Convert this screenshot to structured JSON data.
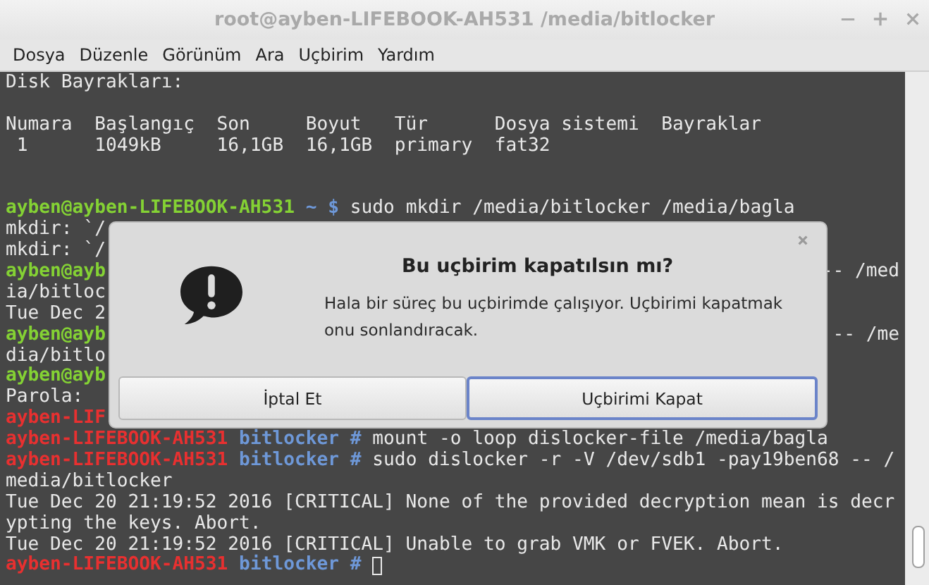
{
  "window": {
    "title": "root@ayben-LIFEBOOK-AH531 /media/bitlocker"
  },
  "menu": [
    "Dosya",
    "Düzenle",
    "Görünüm",
    "Ara",
    "Uçbirim",
    "Yardım"
  ],
  "terminal": {
    "lines": [
      {
        "kind": "text",
        "segments": [
          {
            "kind": "output",
            "text": "Disk Bayrakları:"
          }
        ]
      },
      {
        "kind": "blank"
      },
      {
        "kind": "text",
        "segments": [
          {
            "kind": "output",
            "text": "Numara  Başlangıç  Son     Boyut   Tür      Dosya sistemi  Bayraklar"
          }
        ]
      },
      {
        "kind": "text",
        "segments": [
          {
            "kind": "output",
            "text": " 1      1049kB     16,1GB  16,1GB  primary  fat32"
          }
        ]
      },
      {
        "kind": "blank"
      },
      {
        "kind": "blank"
      },
      {
        "kind": "text",
        "segments": [
          {
            "kind": "user-host",
            "text": "ayben@ayben-LIFEBOOK-AH531"
          },
          {
            "kind": "path",
            "text": " ~ $"
          },
          {
            "kind": "output",
            "text": " sudo mkdir /media/bitlocker /media/bagla"
          }
        ]
      },
      {
        "kind": "text",
        "segments": [
          {
            "kind": "output",
            "text": "mkdir: `/"
          }
        ]
      },
      {
        "kind": "text",
        "segments": [
          {
            "kind": "output",
            "text": "mkdir: `/"
          }
        ]
      },
      {
        "kind": "text",
        "segments": [
          {
            "kind": "user-host",
            "text": "ayben@ayb"
          }
        ],
        "right": "-- /med"
      },
      {
        "kind": "text",
        "segments": [
          {
            "kind": "output",
            "text": "ia/bitloc"
          }
        ]
      },
      {
        "kind": "text",
        "segments": [
          {
            "kind": "output",
            "text": "Tue Dec 2"
          }
        ]
      },
      {
        "kind": "text",
        "segments": [
          {
            "kind": "user-host",
            "text": "ayben@ayb"
          }
        ],
        "right": "-- /me"
      },
      {
        "kind": "text",
        "segments": [
          {
            "kind": "output",
            "text": "dia/bitlo"
          }
        ]
      },
      {
        "kind": "text",
        "segments": [
          {
            "kind": "user-host",
            "text": "ayben@ayb"
          }
        ]
      },
      {
        "kind": "text",
        "segments": [
          {
            "kind": "output",
            "text": "Parola:"
          }
        ]
      },
      {
        "kind": "text",
        "segments": [
          {
            "kind": "root-host",
            "text": "ayben-LIF"
          }
        ]
      },
      {
        "kind": "text",
        "segments": [
          {
            "kind": "root-host",
            "text": "ayben-LIFEBOOK-AH531"
          },
          {
            "kind": "path",
            "text": " bitlocker #"
          },
          {
            "kind": "output",
            "text": " mount -o loop dislocker-file /media/bagla"
          }
        ]
      },
      {
        "kind": "text",
        "segments": [
          {
            "kind": "root-host",
            "text": "ayben-LIFEBOOK-AH531"
          },
          {
            "kind": "path",
            "text": " bitlocker #"
          },
          {
            "kind": "output",
            "text": " sudo dislocker -r -V /dev/sdb1 -pay19ben68 -- /"
          }
        ]
      },
      {
        "kind": "text",
        "segments": [
          {
            "kind": "output",
            "text": "media/bitlocker"
          }
        ]
      },
      {
        "kind": "text",
        "segments": [
          {
            "kind": "output",
            "text": "Tue Dec 20 21:19:52 2016 [CRITICAL] None of the provided decryption mean is decr"
          }
        ]
      },
      {
        "kind": "text",
        "segments": [
          {
            "kind": "output",
            "text": "ypting the keys. Abort."
          }
        ]
      },
      {
        "kind": "text",
        "segments": [
          {
            "kind": "output",
            "text": "Tue Dec 20 21:19:52 2016 [CRITICAL] Unable to grab VMK or FVEK. Abort."
          }
        ]
      },
      {
        "kind": "prompt",
        "segments": [
          {
            "kind": "root-host",
            "text": "ayben-LIFEBOOK-AH531"
          },
          {
            "kind": "path",
            "text": " bitlocker #"
          }
        ]
      }
    ]
  },
  "dialog": {
    "title": "Bu uçbirim kapatılsın mı?",
    "message": "Hala bir süreç bu uçbirimde çalışıyor. Uçbirimi kapatmak onu sonlandıracak.",
    "buttons": [
      {
        "label": "İptal Et",
        "focused": false
      },
      {
        "label": "Uçbirimi Kapat",
        "focused": true
      }
    ]
  }
}
